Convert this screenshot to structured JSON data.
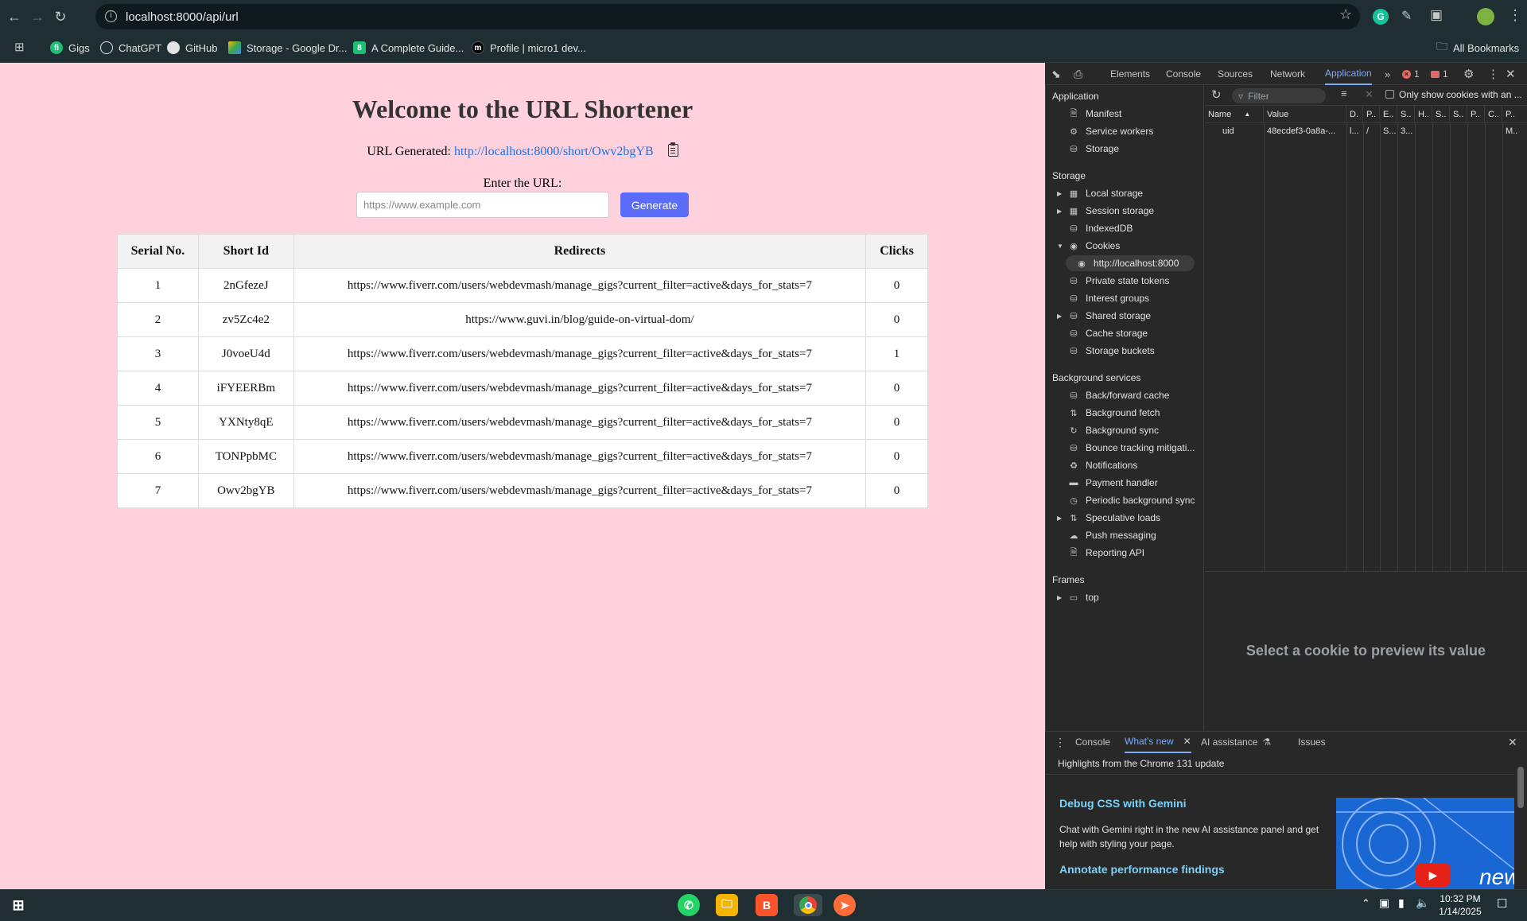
{
  "browser": {
    "url": "localhost:8000/api/url",
    "bookmarks": [
      "Gigs",
      "ChatGPT",
      "GitHub",
      "Storage - Google Dr...",
      "A Complete Guide...",
      "Profile | micro1 dev..."
    ],
    "all_bookmarks": "All Bookmarks"
  },
  "page": {
    "title": "Welcome to the URL Shortener",
    "generated_label": "URL Generated:",
    "generated_url": "http://localhost:8000/short/Owv2bgYB",
    "enter_label": "Enter the URL:",
    "input_placeholder": "https://www.example.com",
    "generate_button": "Generate",
    "table": {
      "headers": [
        "Serial No.",
        "Short Id",
        "Redirects",
        "Clicks"
      ],
      "rows": [
        {
          "serial": "1",
          "short_id": "2nGfezeJ",
          "redirect": "https://www.fiverr.com/users/webdevmash/manage_gigs?current_filter=active&days_for_stats=7",
          "clicks": "0"
        },
        {
          "serial": "2",
          "short_id": "zv5Zc4e2",
          "redirect": "https://www.guvi.in/blog/guide-on-virtual-dom/",
          "clicks": "0"
        },
        {
          "serial": "3",
          "short_id": "J0voeU4d",
          "redirect": "https://www.fiverr.com/users/webdevmash/manage_gigs?current_filter=active&days_for_stats=7",
          "clicks": "1"
        },
        {
          "serial": "4",
          "short_id": "iFYEERBm",
          "redirect": "https://www.fiverr.com/users/webdevmash/manage_gigs?current_filter=active&days_for_stats=7",
          "clicks": "0"
        },
        {
          "serial": "5",
          "short_id": "YXNty8qE",
          "redirect": "https://www.fiverr.com/users/webdevmash/manage_gigs?current_filter=active&days_for_stats=7",
          "clicks": "0"
        },
        {
          "serial": "6",
          "short_id": "TONPpbMC",
          "redirect": "https://www.fiverr.com/users/webdevmash/manage_gigs?current_filter=active&days_for_stats=7",
          "clicks": "0"
        },
        {
          "serial": "7",
          "short_id": "Owv2bgYB",
          "redirect": "https://www.fiverr.com/users/webdevmash/manage_gigs?current_filter=active&days_for_stats=7",
          "clicks": "0"
        }
      ]
    }
  },
  "devtools": {
    "tabs": [
      "Elements",
      "Console",
      "Sources",
      "Network",
      "Application"
    ],
    "error_count": "1",
    "issue_count": "1",
    "sidebar": {
      "application_title": "Application",
      "application_items": [
        "Manifest",
        "Service workers",
        "Storage"
      ],
      "storage_title": "Storage",
      "storage_items": [
        "Local storage",
        "Session storage",
        "IndexedDB",
        "Cookies"
      ],
      "cookie_origin": "http://localhost:8000",
      "storage_items_2": [
        "Private state tokens",
        "Interest groups",
        "Shared storage",
        "Cache storage",
        "Storage buckets"
      ],
      "background_title": "Background services",
      "background_items": [
        "Back/forward cache",
        "Background fetch",
        "Background sync",
        "Bounce tracking mitigati...",
        "Notifications",
        "Payment handler",
        "Periodic background sync",
        "Speculative loads",
        "Push messaging",
        "Reporting API"
      ],
      "frames_title": "Frames",
      "frames_item": "top"
    },
    "cookies": {
      "filter_placeholder": "Filter",
      "only_show_label": "Only show cookies with an ...",
      "columns": [
        "Name",
        "Value",
        "D.",
        "P..",
        "E..",
        "S..",
        "H..",
        "S..",
        "S..",
        "P..",
        "C..",
        "P.."
      ],
      "row": [
        "uid",
        "48ecdef3-0a8a-...",
        "l...",
        "/",
        "S...",
        "3...",
        "",
        "",
        "",
        "",
        "",
        "M.."
      ],
      "preview_text": "Select a cookie to preview its value"
    },
    "drawer": {
      "tabs": [
        "Console",
        "What's new",
        "AI assistance",
        "Issues"
      ],
      "highlights": "Highlights from the Chrome 131 update",
      "heading1": "Debug CSS with Gemini",
      "para1": "Chat with Gemini right in the new AI assistance panel and get help with styling your page.",
      "heading2": "Annotate performance findings",
      "thumb_text": "new"
    }
  },
  "taskbar": {
    "time": "10:32 PM",
    "date": "1/14/2025"
  },
  "colors": {
    "page_bg": "#ffd1dc",
    "button": "#5b6cf9",
    "link": "#1a73e8",
    "devtools_accent": "#7cacf8"
  }
}
